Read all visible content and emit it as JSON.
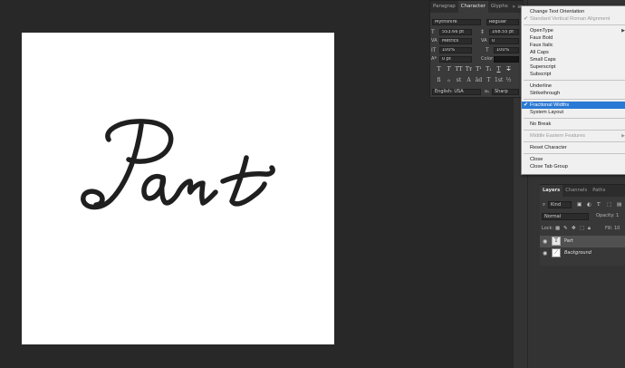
{
  "canvas": {
    "text": "Part"
  },
  "character_panel": {
    "tabs": [
      "Paragrap",
      "Character",
      "Glyphs"
    ],
    "active_tab": "Character",
    "tab_controls": "» ≡",
    "font_family": "Mythshire",
    "font_style": "Regular",
    "font_size": "553.66 pt",
    "leading": "168.55 pt",
    "kerning": "Metrics",
    "tracking": "0",
    "vertical_scale": "100%",
    "horizontal_scale": "100%",
    "baseline_shift": "0 pt",
    "color_label": "Color:",
    "style_buttons": [
      "T",
      "T",
      "TT",
      "Tт",
      "T¹",
      "T₁",
      "T",
      "T"
    ],
    "opentype_buttons": [
      "fi",
      "ℴ",
      "st",
      "A",
      "ād",
      "T",
      "1st",
      "½"
    ],
    "language": "English: USA",
    "antialias_icon": "aₐ",
    "antialias": "Sharp"
  },
  "flyout_menu": {
    "items": [
      {
        "label": "Change Text Orientation",
        "state": "normal"
      },
      {
        "label": "Standard Vertical Roman Alignment",
        "state": "disabled-checked"
      },
      {
        "label": "OpenType",
        "state": "submenu"
      },
      {
        "label": "Faux Bold",
        "state": "normal"
      },
      {
        "label": "Faux Italic",
        "state": "normal"
      },
      {
        "label": "All Caps",
        "state": "normal"
      },
      {
        "label": "Small Caps",
        "state": "normal"
      },
      {
        "label": "Superscript",
        "state": "normal"
      },
      {
        "label": "Subscript",
        "state": "normal"
      },
      {
        "label": "Underline",
        "state": "normal"
      },
      {
        "label": "Strikethrough",
        "state": "normal"
      },
      {
        "label": "Fractional Widths",
        "state": "selected-checked"
      },
      {
        "label": "System Layout",
        "state": "normal"
      },
      {
        "label": "No Break",
        "state": "normal"
      },
      {
        "label": "Middle Eastern Features",
        "state": "disabled-submenu"
      },
      {
        "label": "Reset Character",
        "state": "normal"
      },
      {
        "label": "Close",
        "state": "normal"
      },
      {
        "label": "Close Tab Group",
        "state": "normal"
      }
    ],
    "selected_color": "#2a79d4"
  },
  "layers_panel": {
    "tabs": [
      "Layers",
      "Channels",
      "Paths"
    ],
    "active_tab": "Layers",
    "filter_kind": "Kind",
    "blend_mode": "Normal",
    "opacity_label": "Opacity: 1",
    "lock_label": "Lock:",
    "fill_label": "Fill: 10",
    "layers": [
      {
        "name": "Part",
        "type": "text",
        "thumb": "T",
        "selected": true
      },
      {
        "name": "Background",
        "type": "pixel",
        "thumb": "",
        "selected": false
      }
    ]
  }
}
